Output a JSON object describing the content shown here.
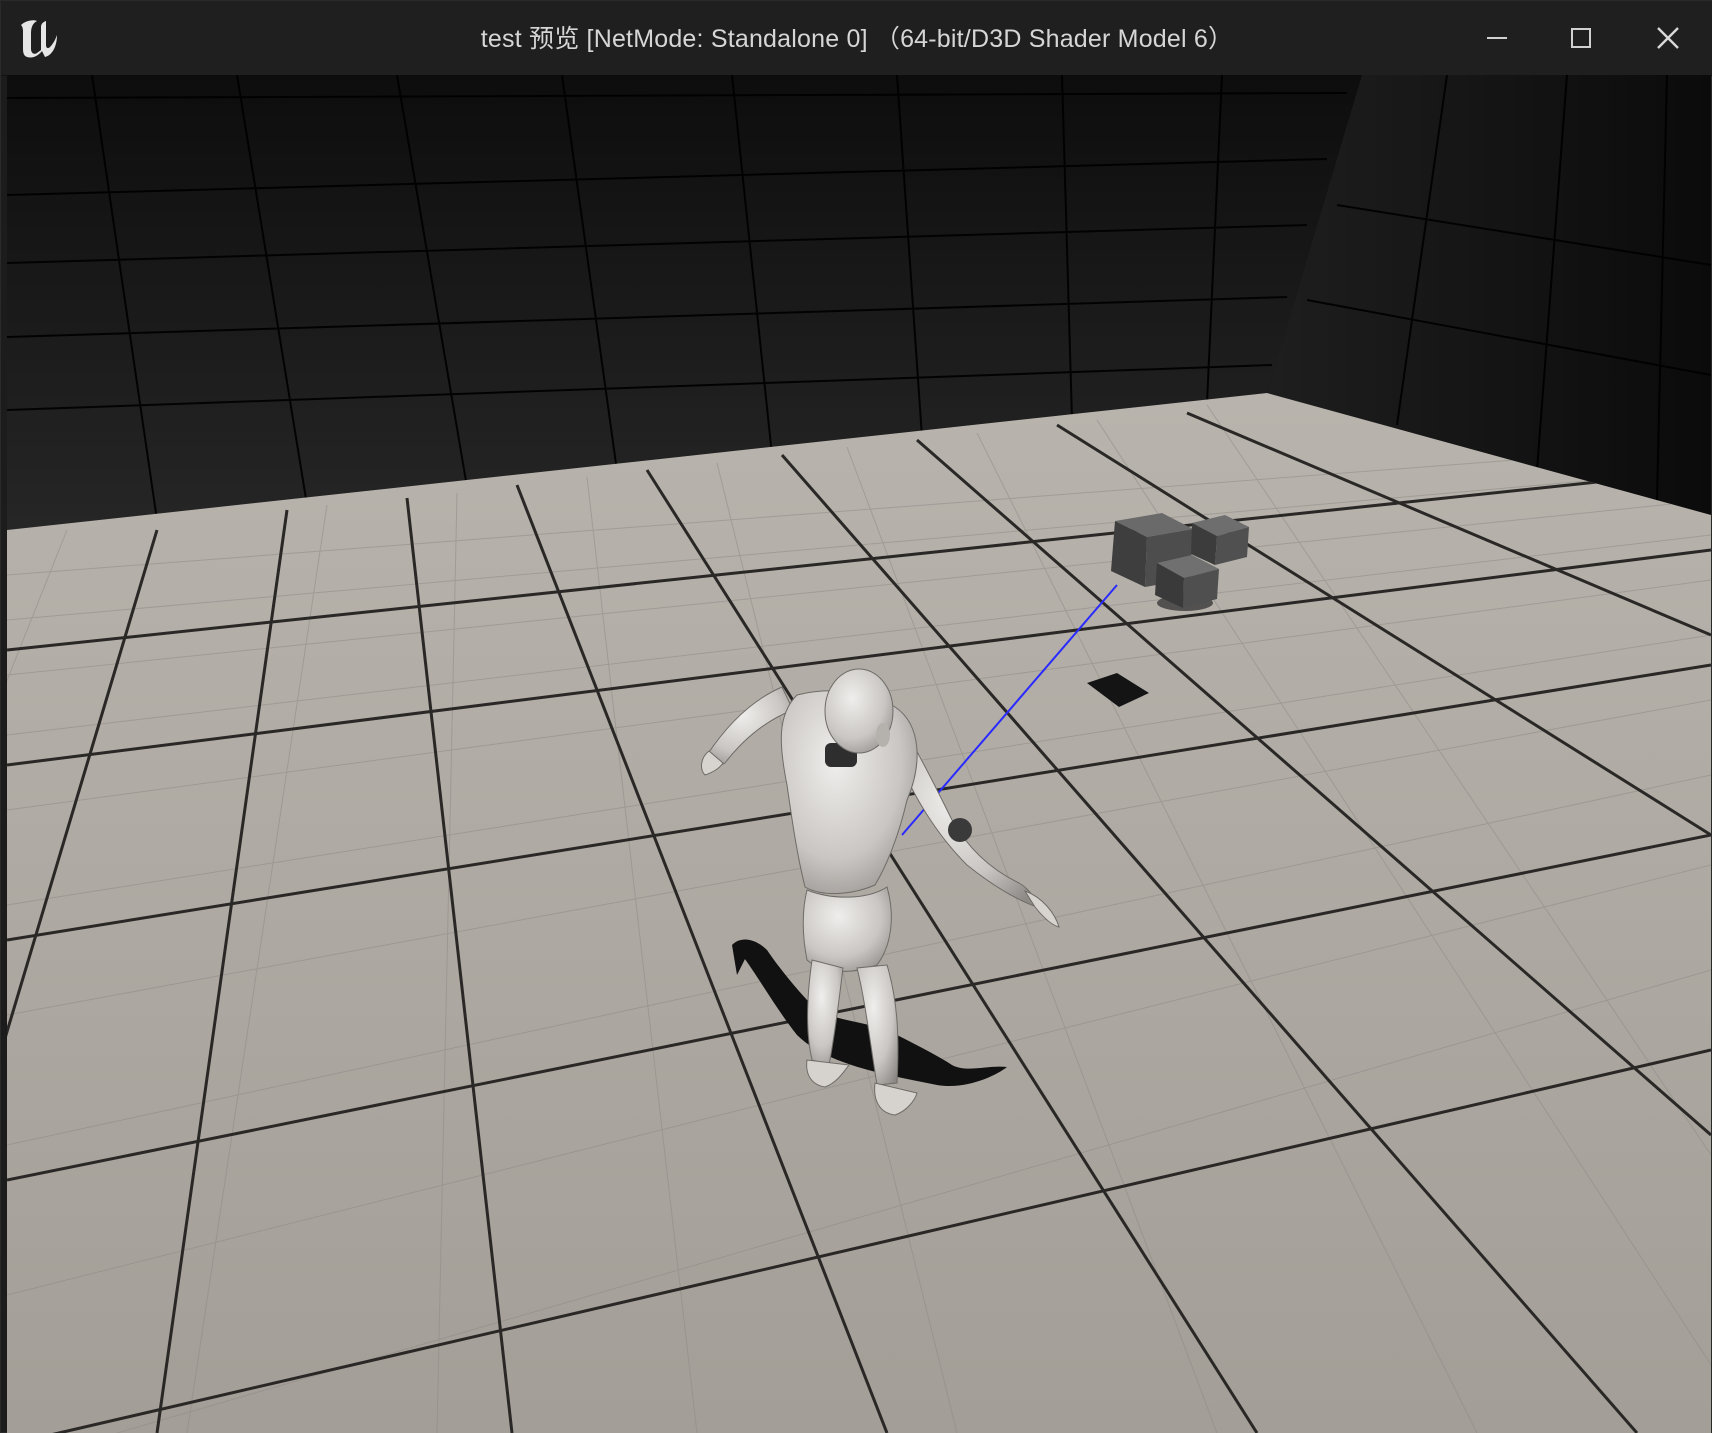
{
  "window": {
    "title": "test 预览 [NetMode: Standalone 0]  （64-bit/D3D Shader Model 6）",
    "app_icon": "unreal-engine-logo-icon",
    "controls": {
      "minimize": "minimize-icon",
      "maximize": "maximize-icon",
      "close": "close-icon"
    }
  },
  "scene": {
    "floor_color": "#a8a39b",
    "wall_color": "#1a1a1a",
    "trace_line_color": "#2a2aff",
    "objects": [
      "mannequin-character",
      "cube-cluster",
      "debug-line",
      "decal-square"
    ]
  }
}
